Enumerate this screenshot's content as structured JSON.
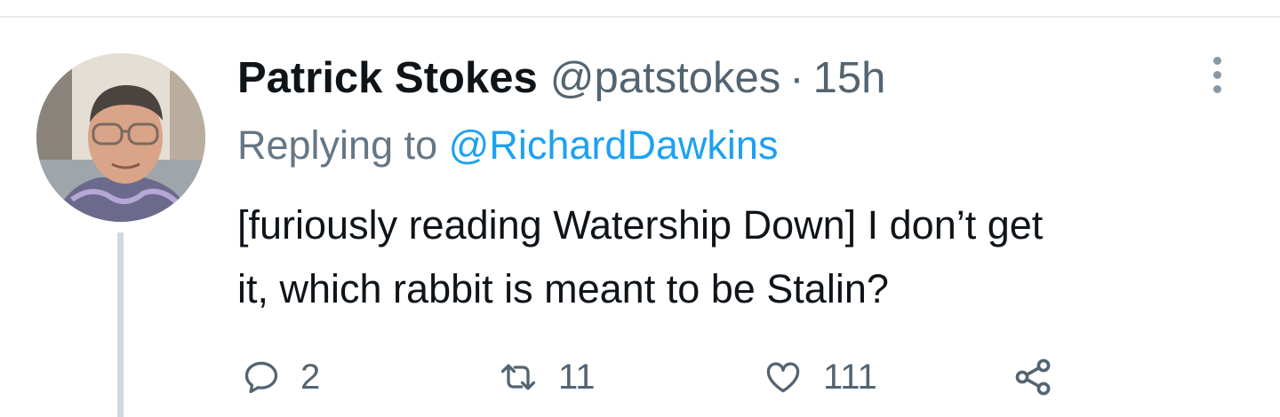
{
  "tweet": {
    "display_name": "Patrick Stokes",
    "handle": "@patstokes",
    "separator": "·",
    "time": "15h",
    "replying_prefix": "Replying to",
    "replying_to": "@RichardDawkins",
    "text_line1": "[furiously reading Watership Down] I don’t get",
    "text_line2": "it, which rabbit is meant to be Stalin?"
  },
  "actions": {
    "reply_count": "2",
    "retweet_count": "11",
    "like_count": "111"
  },
  "icons": {
    "reply": "speech-bubble-icon",
    "retweet": "retweet-arrows-icon",
    "like": "heart-icon",
    "share": "share-nodes-icon",
    "more": "vertical-dots-icon"
  },
  "colors": {
    "text": "#0f1419",
    "secondary": "#536471",
    "link": "#1da1f2",
    "divider": "#e6ecf0"
  }
}
